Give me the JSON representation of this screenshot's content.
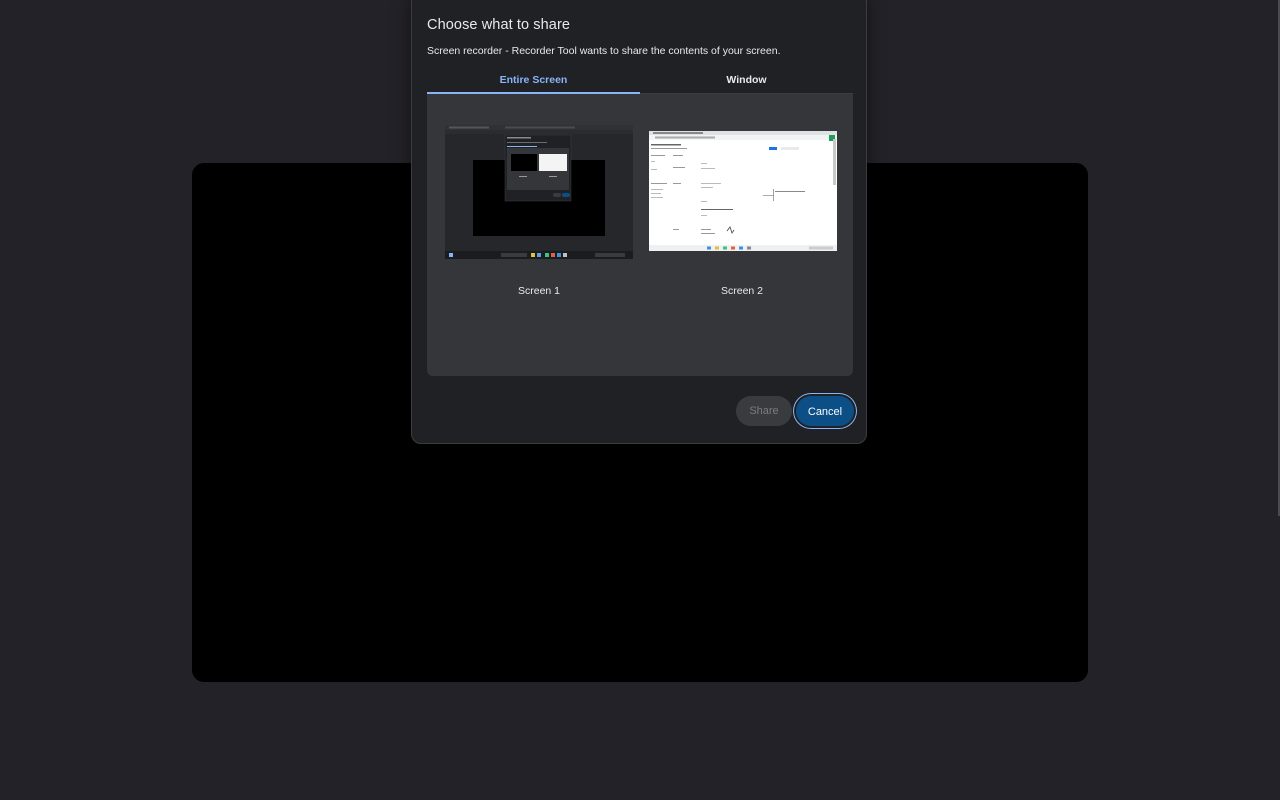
{
  "dialog": {
    "title": "Choose what to share",
    "description": "Screen recorder - Recorder Tool wants to share the contents of your screen."
  },
  "tabs": [
    {
      "label": "Entire Screen",
      "active": true
    },
    {
      "label": "Window",
      "active": false
    }
  ],
  "screens": [
    {
      "label": "Screen 1"
    },
    {
      "label": "Screen 2"
    }
  ],
  "buttons": {
    "share": "Share",
    "cancel": "Cancel"
  },
  "colors": {
    "background": "#232228",
    "dialog": "#202124",
    "panel": "#35363a",
    "accent": "#8ab4f8",
    "primary_button": "#0b4f86"
  }
}
